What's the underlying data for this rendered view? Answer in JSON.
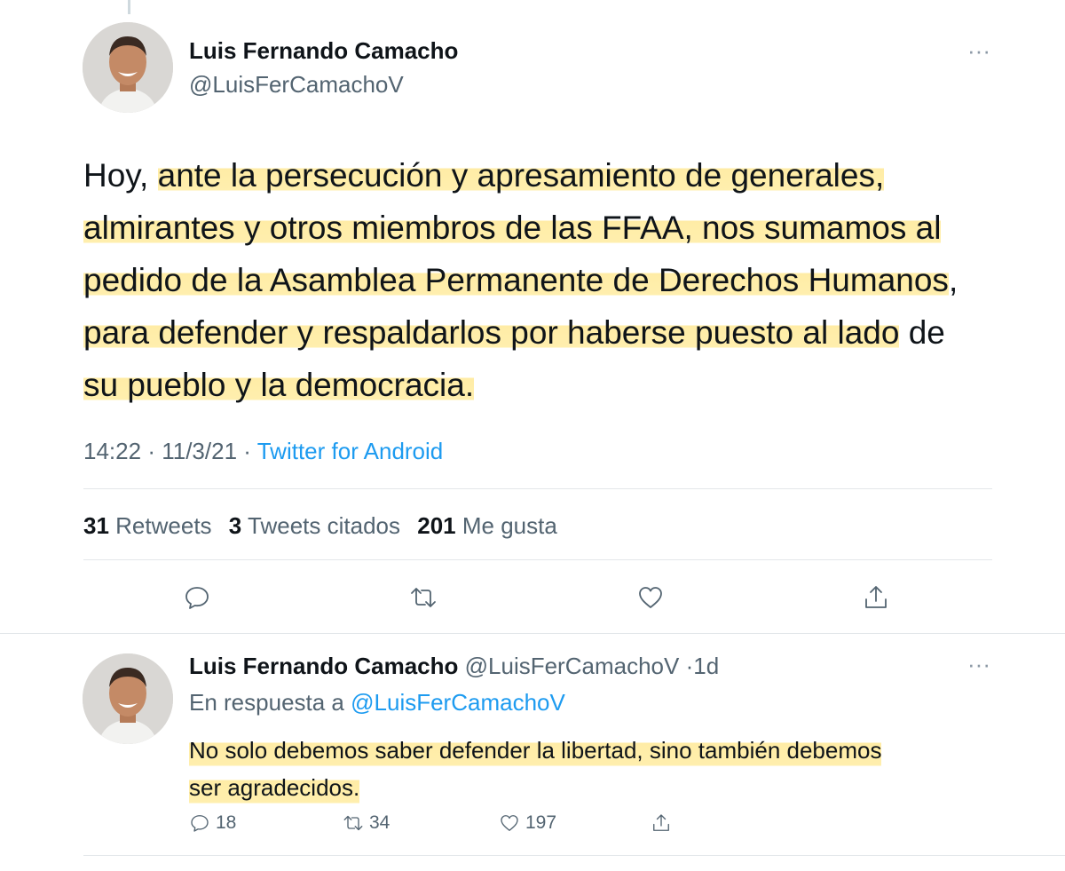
{
  "main_tweet": {
    "name": "Luis Fernando Camacho",
    "handle": "@LuisFerCamachoV",
    "text_lines": [
      {
        "pre": "Hoy, ",
        "hl": "ante la persecución y apresamiento de generales,",
        "post": ""
      },
      {
        "pre": "",
        "hl": "almirantes y otros miembros de las FFAA, nos sumamos al",
        "post": ""
      },
      {
        "pre": "",
        "hl": "pedido de la Asamblea Permanente de Derechos Humanos",
        "post": ","
      },
      {
        "pre": "",
        "hl": "para defender y respaldarlos por haberse puesto al lado",
        "post": " de"
      },
      {
        "pre": "",
        "hl": "su pueblo y la democracia.",
        "post": ""
      }
    ],
    "time": "14:22",
    "separator": "·",
    "date": "11/3/21",
    "source": "Twitter for Android",
    "stats": {
      "retweets_count": "31",
      "retweets_label": "Retweets",
      "quotes_count": "3",
      "quotes_label": "Tweets citados",
      "likes_count": "201",
      "likes_label": "Me gusta"
    }
  },
  "reply_tweet": {
    "name": "Luis Fernando Camacho",
    "handle": "@LuisFerCamachoV",
    "separator": "·",
    "age": "1d",
    "reply_prefix": "En respuesta a",
    "reply_mention": "@LuisFerCamachoV",
    "text_lines": [
      "No solo debemos saber defender la libertad, sino también debemos",
      "ser agradecidos."
    ],
    "replies": "18",
    "retweets": "34",
    "likes": "197"
  },
  "icons": {
    "reply": "speech-bubble-icon",
    "retweet": "retweet-arrows-icon",
    "like": "heart-icon",
    "share": "share-upload-icon",
    "more": "more-dots-icon"
  },
  "colors": {
    "accent": "#1d9bf0",
    "secondary_text": "#536471",
    "highlight": "#ffe996"
  }
}
